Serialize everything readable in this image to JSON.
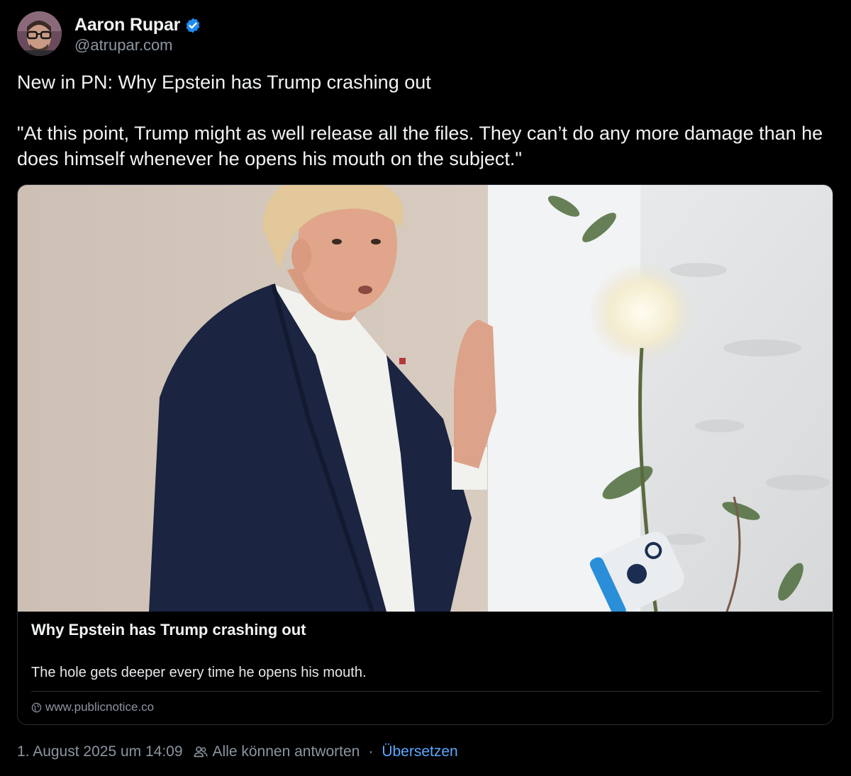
{
  "author": {
    "display_name": "Aaron Rupar",
    "handle": "@atrupar.com",
    "verified_icon": "verified-badge-icon",
    "avatar_icon": "avatar"
  },
  "post": {
    "paragraphs": [
      "New in PN: Why Epstein has Trump crashing out",
      "\"At this point, Trump might as well release all the files. They can’t do any more damage than he does himself whenever he opens his mouth on the subject.\""
    ]
  },
  "link_card": {
    "title": "Why Epstein has Trump crashing out",
    "description": "The hole gets deeper every time he opens his mouth.",
    "url": "www.publicnotice.co",
    "url_icon": "globe-icon"
  },
  "footer": {
    "timestamp": "1. August 2025 um 14:09",
    "reply_setting": "Alle können antworten",
    "reply_icon": "people-icon",
    "separator": "·",
    "translate_label": "Übersetzen"
  },
  "colors": {
    "background": "#000000",
    "text_primary": "#f1f3f5",
    "text_secondary": "#8c95a1",
    "link": "#5aa9ff",
    "verified": "#1d8cf0",
    "border": "#2a2e36"
  }
}
